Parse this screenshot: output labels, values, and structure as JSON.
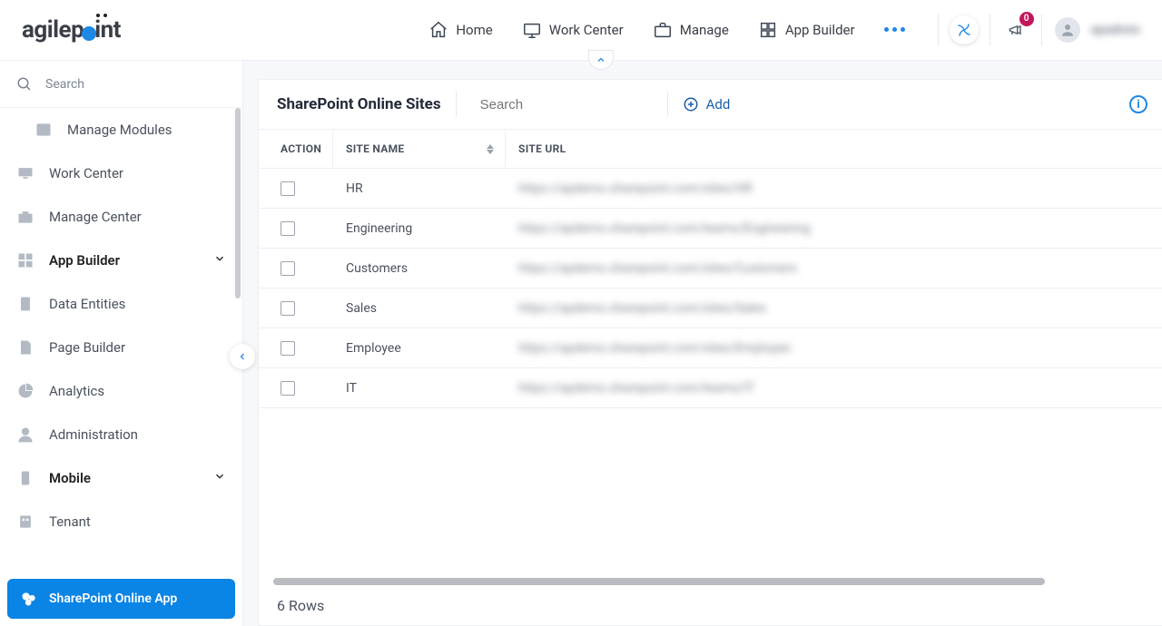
{
  "brand": {
    "name_left": "agilep",
    "name_right": "int"
  },
  "nav": {
    "items": [
      {
        "label": "Home"
      },
      {
        "label": "Work Center"
      },
      {
        "label": "Manage"
      },
      {
        "label": "App Builder"
      }
    ]
  },
  "notifications": {
    "count": "0"
  },
  "user": {
    "name": "apadmin"
  },
  "sidebar": {
    "search_placeholder": "Search",
    "items": [
      {
        "label": "Manage Modules",
        "icon": "modules",
        "indent": true
      },
      {
        "label": "Work Center",
        "icon": "monitor"
      },
      {
        "label": "Manage Center",
        "icon": "briefcase"
      },
      {
        "label": "App Builder",
        "icon": "grid",
        "bold": true,
        "chev": true
      },
      {
        "label": "Data Entities",
        "icon": "db"
      },
      {
        "label": "Page Builder",
        "icon": "page"
      },
      {
        "label": "Analytics",
        "icon": "chart"
      },
      {
        "label": "Administration",
        "icon": "user"
      },
      {
        "label": "Mobile",
        "icon": "phone",
        "bold": true,
        "chev": true
      },
      {
        "label": "Tenant",
        "icon": "tenant"
      }
    ],
    "active": {
      "label": "SharePoint Online App"
    }
  },
  "main": {
    "title": "SharePoint Online Sites",
    "search_placeholder": "Search",
    "add_label": "Add",
    "columns": {
      "action": "ACTION",
      "name": "SITE NAME",
      "url": "SITE URL"
    },
    "rows": [
      {
        "name": "HR",
        "url": "https://apdemo.sharepoint.com/sites/HR"
      },
      {
        "name": "Engineering",
        "url": "https://apdemo.sharepoint.com/teams/Engineering"
      },
      {
        "name": "Customers",
        "url": "https://apdemo.sharepoint.com/sites/Customers"
      },
      {
        "name": "Sales",
        "url": "https://apdemo.sharepoint.com/sites/Sales"
      },
      {
        "name": "Employee",
        "url": "https://apdemo.sharepoint.com/sites/Employee"
      },
      {
        "name": "IT",
        "url": "https://apdemo.sharepoint.com/teams/IT"
      }
    ],
    "row_count_label": "6 Rows"
  }
}
